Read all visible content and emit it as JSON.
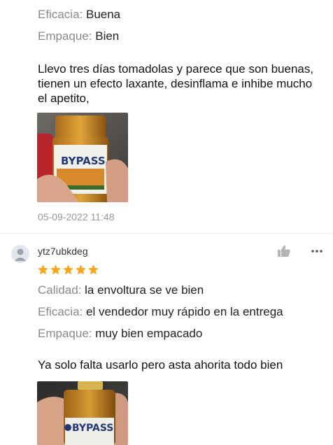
{
  "review1": {
    "eficacia_label": "Eficacia:",
    "eficacia_value": "Buena",
    "empaque_label": "Empaque:",
    "empaque_value": "Bien",
    "text": "Llevo tres días tomadolas y parece que son buenas, tienen un efecto laxante, desinflama e inhibe mucho el apetito,",
    "photo_brand": "BYPASS",
    "date": "05-09-2022 11:48"
  },
  "review2": {
    "username": "ytz7ubkdeg",
    "rating": 5,
    "calidad_label": "Calidad:",
    "calidad_value": "la envoltura se ve bien",
    "eficacia_label": "Eficacia:",
    "eficacia_value": "el vendedor muy rápido en la entrega",
    "empaque_label": "Empaque:",
    "empaque_value": "muy bien empacado",
    "text": "Ya solo falta usarlo pero asta ahorita todo bien",
    "photo_brand": "BYPASS"
  },
  "icons": {
    "avatar": "user-avatar-icon",
    "like": "thumbs-up-icon",
    "more": "more-dots-icon",
    "star": "star-icon"
  },
  "colors": {
    "star": "#f5a623",
    "label": "#8a8a8a",
    "icon": "#b5b5b5",
    "date": "#999999"
  }
}
